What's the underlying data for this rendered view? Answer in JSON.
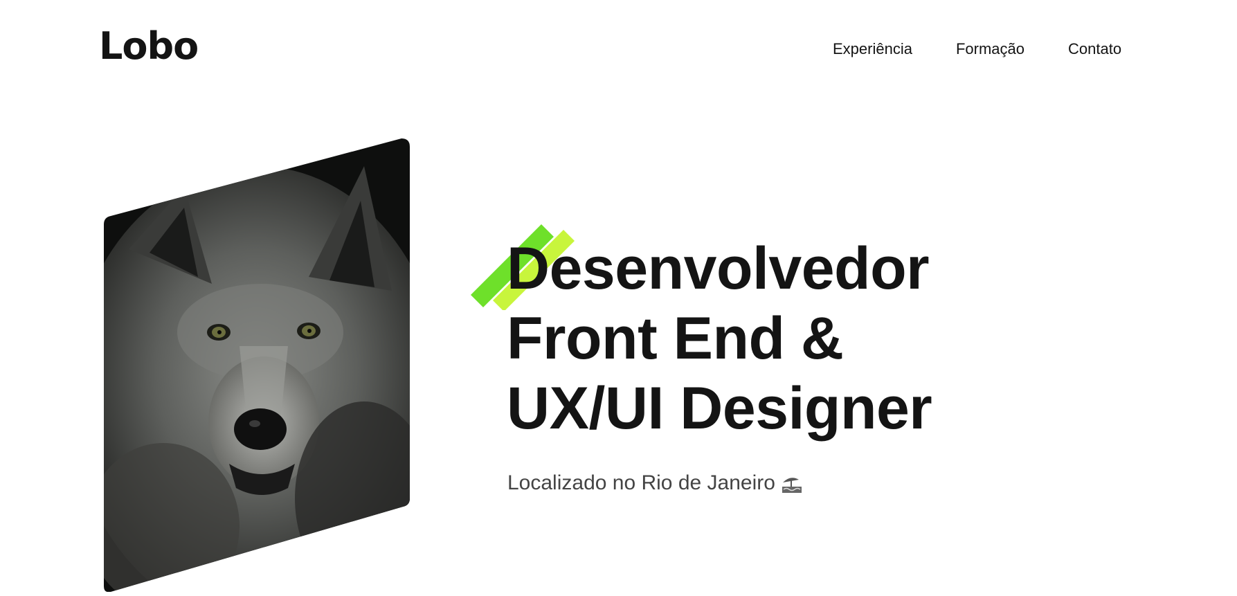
{
  "header": {
    "logo": "Lobo",
    "nav": [
      {
        "label": "Experiência"
      },
      {
        "label": "Formação"
      },
      {
        "label": "Contato"
      }
    ]
  },
  "hero": {
    "headline_lines": [
      "Desenvolvedor",
      "Front End &",
      "UX/UI Designer"
    ],
    "location": "Localizado no Rio de Janeiro",
    "location_icon": "beach-umbrella-icon",
    "image_icon": "wolf-portrait-image",
    "accent_colors": [
      "#6ee02a",
      "#c8f53c"
    ]
  }
}
